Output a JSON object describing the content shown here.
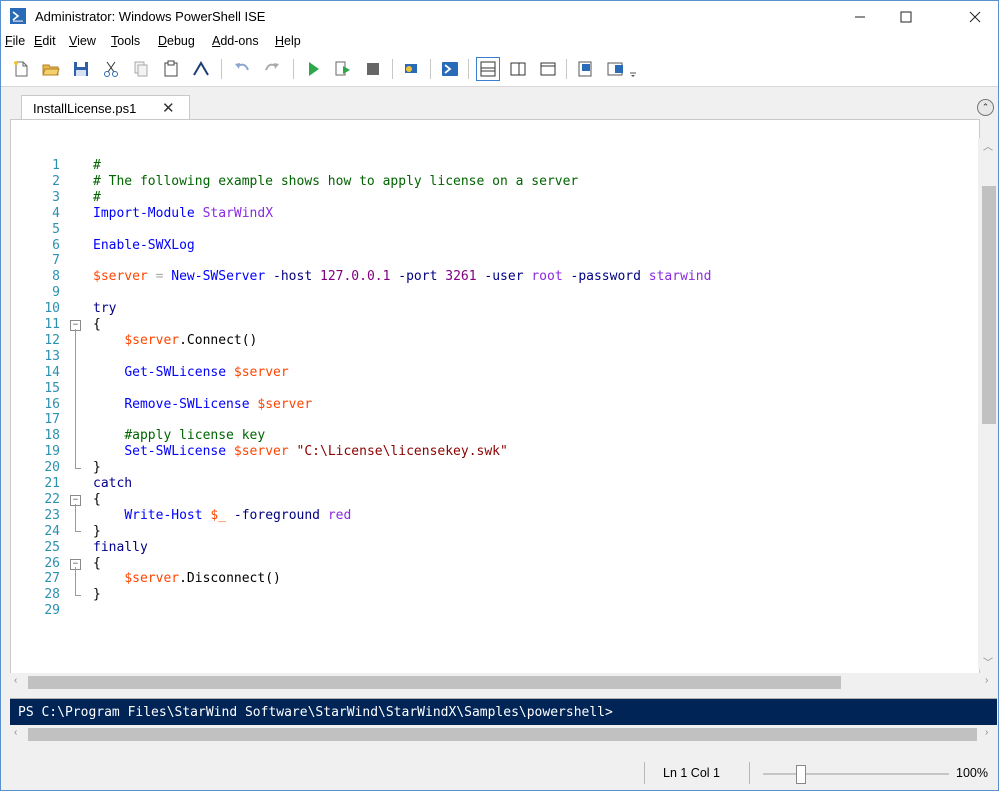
{
  "window": {
    "title": "Administrator: Windows PowerShell ISE"
  },
  "menu": [
    {
      "label": "File",
      "ul": "F"
    },
    {
      "label": "Edit",
      "ul": "E"
    },
    {
      "label": "View",
      "ul": "V"
    },
    {
      "label": "Tools",
      "ul": "T"
    },
    {
      "label": "Debug",
      "ul": "D"
    },
    {
      "label": "Add-ons",
      "ul": "A"
    },
    {
      "label": "Help",
      "ul": "H"
    }
  ],
  "tab": {
    "label": "InstallLicense.ps1",
    "close": "✕"
  },
  "line_numbers": [
    "1",
    "2",
    "3",
    "4",
    "5",
    "6",
    "7",
    "8",
    "9",
    "10",
    "11",
    "12",
    "13",
    "14",
    "15",
    "16",
    "17",
    "18",
    "19",
    "20",
    "21",
    "22",
    "23",
    "24",
    "25",
    "26",
    "27",
    "28",
    "29"
  ],
  "code": {
    "l1": "#",
    "l2": "# The following example shows how to apply license on a server",
    "l3": "#",
    "l4_cmd": "Import-Module",
    "l4_arg": "StarWindX",
    "l6_cmd": "Enable-SWXLog",
    "l8_var": "$server",
    "l8_op": "=",
    "l8_cmd": "New-SWServer",
    "l8_p1": "-host",
    "l8_v1": "127.0.0.1",
    "l8_p2": "-port",
    "l8_v2": "3261",
    "l8_p3": "-user",
    "l8_v3": "root",
    "l8_p4": "-password",
    "l8_v4": "starwind",
    "l10": "try",
    "brace_open": "{",
    "brace_close": "}",
    "l12_var": "$server",
    "l12_meth": ".Connect()",
    "l14_cmd": "Get-SWLicense",
    "l14_var": "$server",
    "l16_cmd": "Remove-SWLicense",
    "l16_var": "$server",
    "l18": "#apply license key",
    "l19_cmd": "Set-SWLicense",
    "l19_var": "$server",
    "l19_str": "\"C:\\License\\licensekey.swk\"",
    "l21": "catch",
    "l23_cmd": "Write-Host",
    "l23_var": "$_",
    "l23_param": "-foreground",
    "l23_arg": "red",
    "l25": "finally",
    "l27_var": "$server",
    "l27_meth": ".Disconnect()"
  },
  "console": {
    "prompt": "PS C:\\Program Files\\StarWind Software\\StarWind\\StarWindX\\Samples\\powershell>"
  },
  "status": {
    "position": "Ln 1  Col 1",
    "zoom": "100%",
    "zoom_level_percent": 100
  }
}
